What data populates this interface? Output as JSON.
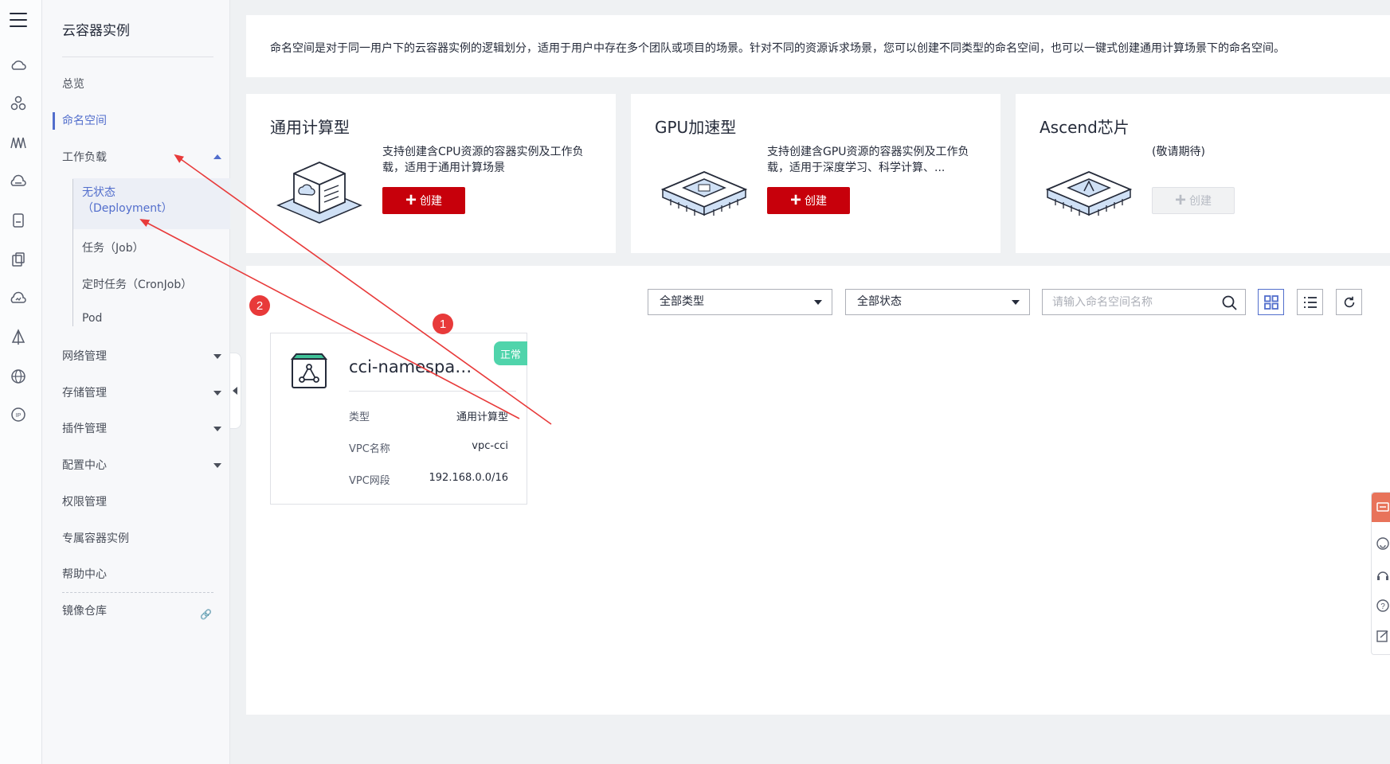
{
  "sidebar": {
    "title": "云容器实例",
    "items": [
      {
        "label": "总览"
      },
      {
        "label": "命名空间"
      },
      {
        "label": "工作负载"
      },
      {
        "label": "网络管理"
      },
      {
        "label": "存储管理"
      },
      {
        "label": "插件管理"
      },
      {
        "label": "配置中心"
      },
      {
        "label": "权限管理"
      },
      {
        "label": "专属容器实例"
      },
      {
        "label": "帮助中心"
      },
      {
        "label": "镜像仓库"
      }
    ],
    "workload_sub": [
      {
        "label": "无状态",
        "label2": "（Deployment）"
      },
      {
        "label": "任务（Job）"
      },
      {
        "label": "定时任务（CronJob）"
      },
      {
        "label": "Pod"
      }
    ]
  },
  "intro": {
    "text": "命名空间是对于同一用户下的云容器实例的逻辑划分，适用于用户中存在多个团队或项目的场景。针对不同的资源诉求场景，您可以创建不同类型的命名空间，也可以一键式创建通用计算场景下的命名空间。"
  },
  "cards": [
    {
      "title": "通用计算型",
      "desc": "支持创建含CPU资源的容器实例及工作负载，适用于通用计算场景",
      "button": "创建"
    },
    {
      "title": "GPU加速型",
      "desc": "支持创建含GPU资源的容器实例及工作负载，适用于深度学习、科学计算、...",
      "button": "创建"
    },
    {
      "title": "Ascend芯片",
      "desc": "(敬请期待)",
      "button": "创建"
    }
  ],
  "filters": {
    "type_select": "全部类型",
    "status_select": "全部状态",
    "search_placeholder": "请输入命名空间名称"
  },
  "namespace": {
    "name": "cci-namespace...",
    "status": "正常",
    "rows": [
      {
        "key": "类型",
        "value": "通用计算型"
      },
      {
        "key": "VPC名称",
        "value": "vpc-cci"
      },
      {
        "key": "VPC网段",
        "value": "192.168.0.0/16"
      }
    ]
  },
  "annotations": {
    "badge1": "1",
    "badge2": "2"
  },
  "colors": {
    "accent": "#526ecc",
    "create_button": "#c7000b",
    "status_ok": "#50d4ab",
    "annotation": "#e83a3a"
  }
}
